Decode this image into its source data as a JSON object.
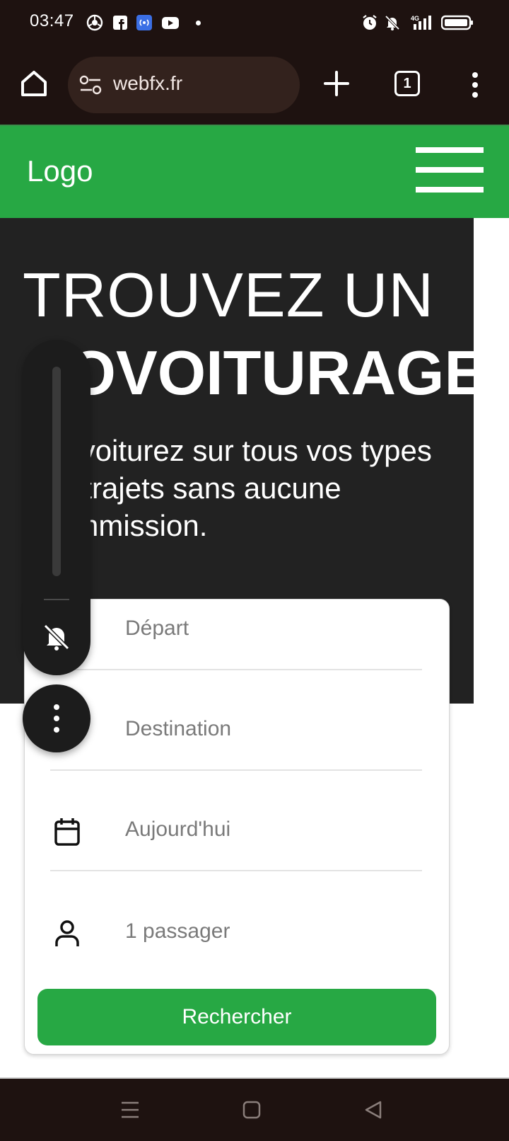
{
  "status_bar": {
    "time": "03:47",
    "icons": [
      "chrome-sync-icon",
      "facebook-icon",
      "hotspot-icon",
      "youtube-icon",
      "alarm-icon",
      "muted-bell-icon",
      "signal-4g-icon",
      "battery-icon"
    ],
    "network": "4G"
  },
  "browser": {
    "url": "webfx.fr",
    "tab_count": "1"
  },
  "header": {
    "logo": "Logo"
  },
  "hero": {
    "title_line1": "TROUVEZ UN",
    "title_line2": "COVOITURAGE",
    "subtitle": "Covoiturez sur tous vos types de trajets sans aucune commission."
  },
  "search": {
    "departure_placeholder": "Départ",
    "destination_placeholder": "Destination",
    "date_value": "Aujourd'hui",
    "passengers_value": "1 passager",
    "button_label": "Rechercher"
  },
  "colors": {
    "brand_green": "#27a844",
    "hero_bg": "#222222",
    "system_bar": "#1e1210"
  }
}
